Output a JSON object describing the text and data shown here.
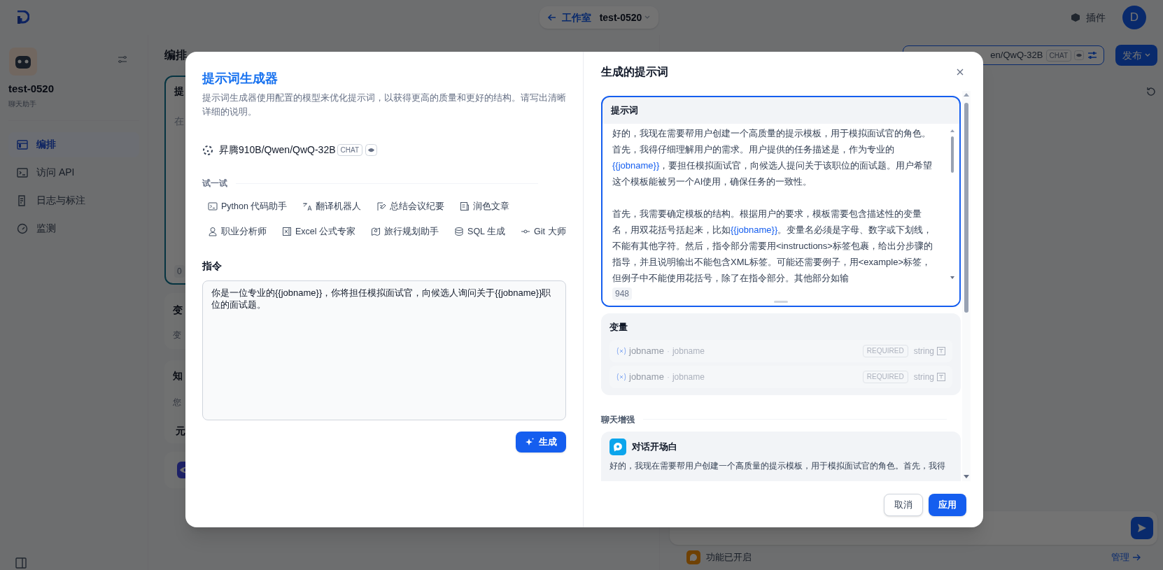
{
  "top_bar": {
    "back_label": "工作室",
    "app_name": "test-0520",
    "plugins": "插件",
    "avatar": "D"
  },
  "sidebar": {
    "app_name": "test-0520",
    "app_type": "聊天助手",
    "items": [
      {
        "label": "编排",
        "selected": true
      },
      {
        "label": "访问 API",
        "selected": false
      },
      {
        "label": "日志与标注",
        "selected": false
      },
      {
        "label": "监测",
        "selected": false
      }
    ]
  },
  "orchestrate": {
    "title": "编排",
    "prompt_card": {
      "title": "提",
      "placeholder": "在",
      "count": "0"
    },
    "variables_card": {
      "title": "变",
      "hint": "变"
    },
    "knowledge_card": {
      "title": "知",
      "hint": "您",
      "section": "元"
    }
  },
  "debug_panel": {
    "model_button": {
      "model": "en/QwQ-32B",
      "badge": "CHAT"
    },
    "publish_button": "发布",
    "feature_status": "功能已开启",
    "manage_link": "管理"
  },
  "generator": {
    "title": "提示词生成器",
    "description": "提示词生成器使用配置的模型来优化提示词，以获得更高的质量和更好的结构。请写出清晰详细的说明。",
    "model": {
      "name": "昇腾910B/Qwen/QwQ-32B",
      "badge": "CHAT"
    },
    "try_label": "试一试",
    "template_rows": [
      [
        "Python 代码助手",
        "翻译机器人",
        "总结会议纪要",
        "润色文章"
      ],
      [
        "职业分析师",
        "Excel 公式专家",
        "旅行规划助手",
        "SQL 生成",
        "Git 大师"
      ]
    ],
    "instruction_label": "指令",
    "instruction": "你是一位专业的{{jobname}}，你将担任模拟面试官，向候选人询问关于{{jobname}}职位的面试题。",
    "generate_button": "生成"
  },
  "result": {
    "title": "生成的提示词",
    "prompt": {
      "title": "提示词",
      "paragraphs": [
        [
          {
            "kind": "text",
            "text": "好的，我现在需要帮用户创建一个高质量的提示模板，用于模拟面试官的角色。首先，我得仔细理解用户的需求。用户提供的任务描述是，作为专业的"
          },
          {
            "kind": "variable",
            "text": "{{jobname}}"
          },
          {
            "kind": "text",
            "text": "，要担任模拟面试官，向候选人提问关于该职位的面试题。用户希望这个模板能被另一个AI使用，确保任务的一致性。"
          }
        ],
        [
          {
            "kind": "text",
            "text": "首先，我需要确定模板的结构。根据用户的要求，模板需要包含描述性的变量名，用双花括号括起来，比如"
          },
          {
            "kind": "variable",
            "text": "{{jobname}}"
          },
          {
            "kind": "text",
            "text": "。变量名必须是字母、数字或下划线，不能有其他字符。然后，指令部分需要用<instructions>标签包裹，给出分步骤的指导，并且说明输出不能包含XML标签。可能还需要例子，用<example>标签，但例子中不能使用花括号，除了在指令部分。其他部分如输"
          }
        ]
      ],
      "count": "948"
    },
    "variables": {
      "title": "变量",
      "items": [
        {
          "key": "jobname",
          "separator": "·",
          "name": "jobname",
          "required": "REQUIRED",
          "type": "string",
          "disabled": true
        },
        {
          "key": "jobname",
          "separator": "·",
          "name": "jobname",
          "required": "REQUIRED",
          "type": "string",
          "disabled": true
        }
      ]
    },
    "chat_enhance": {
      "label": "聊天增强",
      "opening": {
        "title": "对话开场白",
        "text": "好的，我现在需要帮用户创建一个高质量的提示模板，用于模拟面试官的角色。首先，我得"
      }
    },
    "buttons": {
      "cancel": "取消",
      "apply": "应用"
    }
  }
}
